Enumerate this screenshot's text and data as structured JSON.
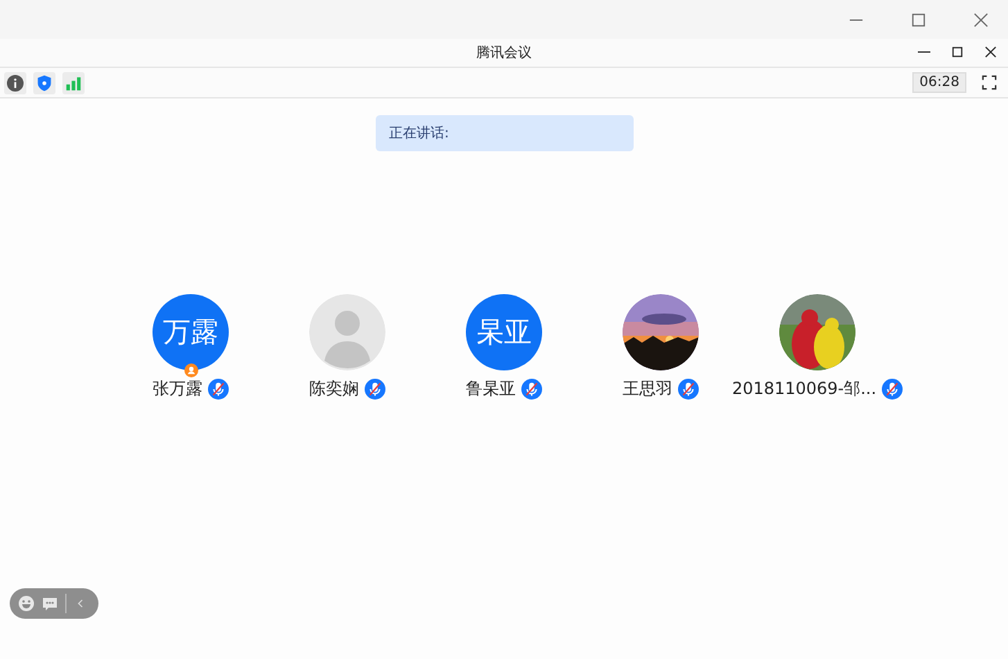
{
  "window": {
    "title": "腾讯会议"
  },
  "toolbar": {
    "timer": "06:28"
  },
  "speaking": {
    "label": "正在讲话:"
  },
  "participants": [
    {
      "name": "张万露",
      "avatar": {
        "kind": "initials",
        "text": "万露"
      },
      "host": true,
      "muted": true
    },
    {
      "name": "陈奕娴",
      "avatar": {
        "kind": "placeholder"
      },
      "host": false,
      "muted": true
    },
    {
      "name": "鲁杲亚",
      "avatar": {
        "kind": "initials",
        "text": "杲亚"
      },
      "host": false,
      "muted": true
    },
    {
      "name": "王思羽",
      "host": false,
      "muted": true
    },
    {
      "name": "2018110069-邹...",
      "host": false,
      "muted": true
    }
  ]
}
